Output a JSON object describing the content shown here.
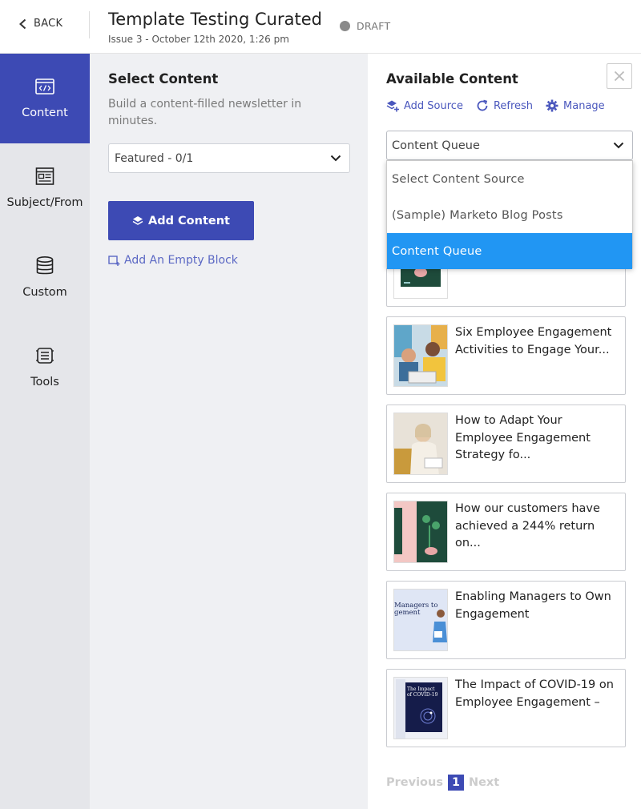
{
  "header": {
    "back_label": "BACK",
    "title": "Template Testing Curated",
    "subtitle": "Issue 3 - October 12th 2020, 1:26 pm",
    "status": "DRAFT"
  },
  "nav": {
    "items": [
      {
        "label": "Content",
        "icon": "code-window-icon",
        "active": true
      },
      {
        "label": "Subject/From",
        "icon": "newsletter-icon",
        "active": false
      },
      {
        "label": "Custom",
        "icon": "database-icon",
        "active": false
      },
      {
        "label": "Tools",
        "icon": "tools-icon",
        "active": false
      }
    ]
  },
  "select_content": {
    "heading": "Select Content",
    "description": "Build a content-filled newsletter in minutes.",
    "featured_value": "Featured - 0/1",
    "add_button": "Add Content",
    "empty_block_link": "Add An Empty Block"
  },
  "available": {
    "heading": "Available Content",
    "toolbar": {
      "add_source": "Add Source",
      "refresh": "Refresh",
      "manage": "Manage"
    },
    "source_value": "Content Queue",
    "dropdown_options": [
      {
        "label": "Select Content Source",
        "selected": false
      },
      {
        "label": "(Sample) Marketo Blog Posts",
        "selected": false
      },
      {
        "label": "Content Queue",
        "selected": true
      }
    ],
    "cards": [
      {
        "title": ""
      },
      {
        "title": "Six Employee Engagement Activities to Engage Your..."
      },
      {
        "title": "How to Adapt Your Employee Engagement Strategy fo..."
      },
      {
        "title": "How our customers have achieved a 244% return on..."
      },
      {
        "title": "Enabling Managers to Own Engagement"
      },
      {
        "title": "The Impact of COVID-19 on Employee Engagement –"
      }
    ],
    "thumb_texts": {
      "managers": "Managers to\nEngagement"
    },
    "pager": {
      "previous": "Previous",
      "page": "1",
      "next": "Next"
    }
  },
  "colors": {
    "accent": "#3d4ab4",
    "dropdown_selected": "#2196f3",
    "link": "#4a57bd"
  }
}
